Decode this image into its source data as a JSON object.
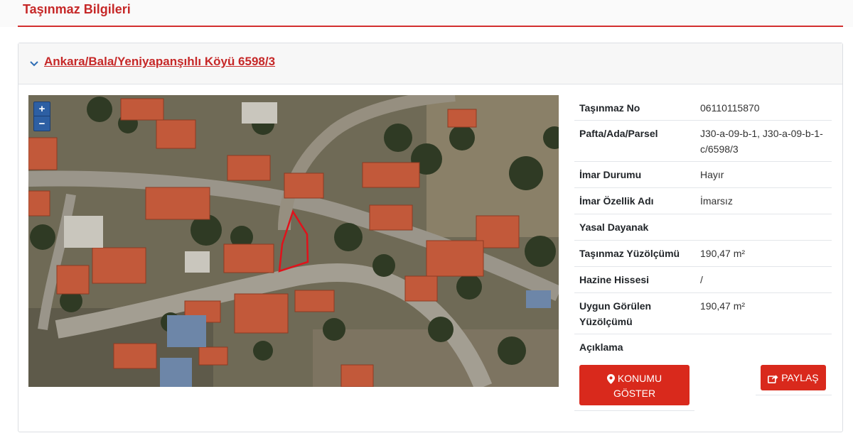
{
  "page": {
    "title": "Taşınmaz Bilgileri"
  },
  "card": {
    "link_text": "Ankara/Bala/Yeniyapanşıhlı Köyü 6598/3"
  },
  "map": {
    "zoom_in": "+",
    "zoom_out": "−"
  },
  "info": {
    "rows": [
      {
        "label": "Taşınmaz No",
        "value": "06110115870"
      },
      {
        "label": "Pafta/Ada/Parsel",
        "value": "J30-a-09-b-1, J30-a-09-b-1-c/6598/3"
      },
      {
        "label": "İmar Durumu",
        "value": "Hayır"
      },
      {
        "label": "İmar Özellik Adı",
        "value": "İmarsız"
      },
      {
        "label": "Yasal Dayanak",
        "value": ""
      },
      {
        "label": "Taşınmaz Yüzölçümü",
        "value": "190,47 m²"
      },
      {
        "label": "Hazine Hissesi",
        "value": "/"
      },
      {
        "label": "Uygun Görülen Yüzölçümü",
        "value": "190,47 m²"
      },
      {
        "label": "Açıklama",
        "value": ""
      }
    ]
  },
  "actions": {
    "location_line1": "KONUMU",
    "location_line2": "GÖSTER",
    "share": "PAYLAŞ"
  },
  "colors": {
    "accent": "#d9291c",
    "title_red": "#c62828",
    "parcel_outline": "#e0121b"
  },
  "icons": [
    "chevron-down-icon",
    "map-marker-icon",
    "share-icon"
  ]
}
